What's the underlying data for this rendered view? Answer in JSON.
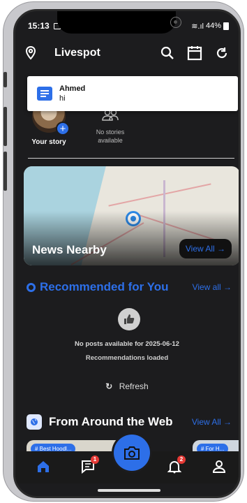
{
  "status_bar": {
    "time": "15:13",
    "battery": "44%"
  },
  "app_bar": {
    "title": "Livespot"
  },
  "notification": {
    "sender": "Ahmed",
    "message": "hi"
  },
  "stories": {
    "your_story_label": "Your story",
    "empty_label_line1": "No stories",
    "empty_label_line2": "available"
  },
  "news_nearby": {
    "title": "News Nearby",
    "view_all": "View All →"
  },
  "recommended": {
    "title": "Recommended for You",
    "view_all": "View all →",
    "empty_message": "No posts available for 2025-06-12",
    "status_message": "Recommendations loaded",
    "refresh_label": "Refresh"
  },
  "from_web": {
    "title": "From Around the Web",
    "view_all": "View All →",
    "card1_chip": "# Best Hoodl...",
    "card2_chip": "# For H..."
  },
  "bottom_nav": {
    "chat_badge": "1",
    "notifications_badge": "2"
  },
  "colors": {
    "accent": "#2d6fe8",
    "background": "#1c1c1e",
    "badge": "#e53935"
  }
}
